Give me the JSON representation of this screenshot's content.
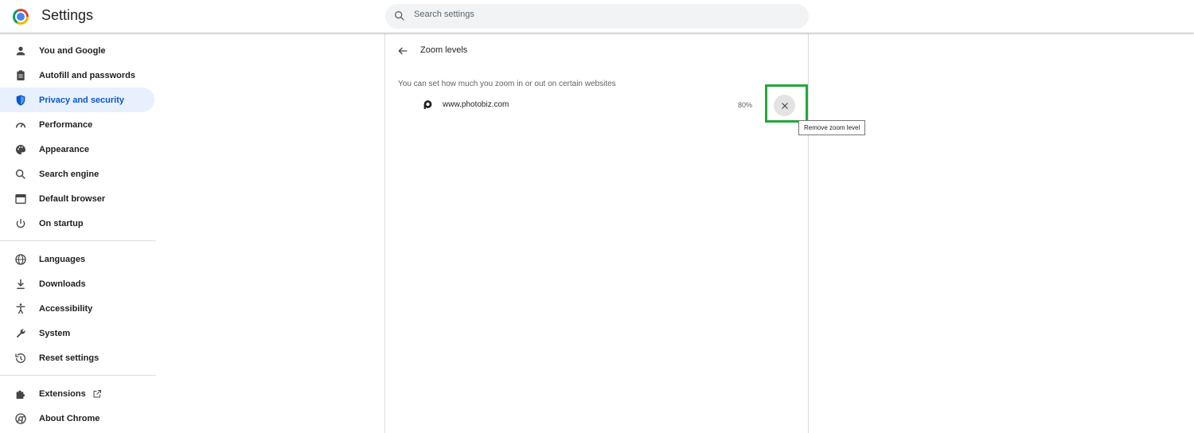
{
  "header": {
    "title": "Settings",
    "search_placeholder": "Search settings"
  },
  "sidebar": {
    "items": [
      {
        "label": "You and Google",
        "icon": "person-icon"
      },
      {
        "label": "Autofill and passwords",
        "icon": "clipboard-icon"
      },
      {
        "label": "Privacy and security",
        "icon": "shield-icon",
        "active": true
      },
      {
        "label": "Performance",
        "icon": "speedometer-icon"
      },
      {
        "label": "Appearance",
        "icon": "palette-icon"
      },
      {
        "label": "Search engine",
        "icon": "search-icon"
      },
      {
        "label": "Default browser",
        "icon": "browser-window-icon"
      },
      {
        "label": "On startup",
        "icon": "power-icon"
      },
      {
        "label": "Languages",
        "icon": "globe-icon"
      },
      {
        "label": "Downloads",
        "icon": "download-icon"
      },
      {
        "label": "Accessibility",
        "icon": "accessibility-icon"
      },
      {
        "label": "System",
        "icon": "wrench-icon"
      },
      {
        "label": "Reset settings",
        "icon": "history-icon"
      },
      {
        "label": "Extensions",
        "icon": "puzzle-icon"
      },
      {
        "label": "About Chrome",
        "icon": "chrome-icon"
      }
    ]
  },
  "main": {
    "title": "Zoom levels",
    "description": "You can set how much you zoom in or out on certain websites",
    "sites": [
      {
        "name": "www.photobiz.com",
        "zoom": "80%"
      }
    ],
    "remove_tooltip": "Remove zoom level"
  },
  "colors": {
    "accent": "#0b57d0",
    "active_bg": "#e8f0fe",
    "highlight": "#22a83a"
  }
}
